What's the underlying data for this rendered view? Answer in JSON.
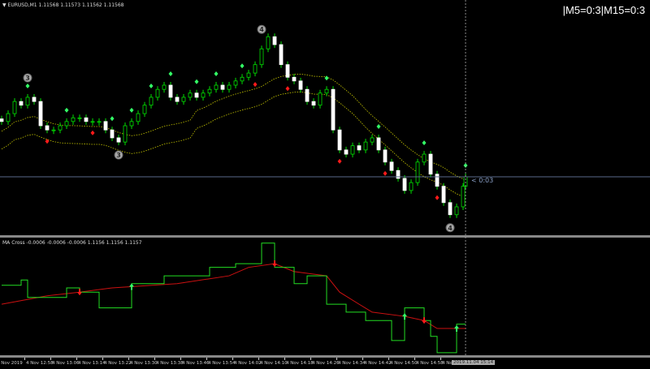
{
  "header": {
    "symbol_line": "▼ EURUSD,M1  1.11568 1.11573 1.11562 1.11568",
    "indicator_line": "MA Cross -0.0006 -0.0006 -0.0006    1.1156 1.1156 1.1157",
    "mtf_status": "|M5=0:3|M15=0:3",
    "countdown": "< 0:03"
  },
  "time_axis": {
    "labels": [
      "4 Nov 2019",
      "4 Nov 12:58",
      "4 Nov 13:06",
      "4 Nov 13:14",
      "4 Nov 13:22",
      "4 Nov 13:30",
      "4 Nov 13:38",
      "4 Nov 13:46",
      "4 Nov 13:54",
      "4 Nov 14:02",
      "4 Nov 14:10",
      "4 Nov 14:18",
      "4 Nov 14:26",
      "4 Nov 14:34",
      "4 Nov 14:42",
      "4 Nov 14:50",
      "4 Nov 14:58",
      "4 Nov 15:06"
    ],
    "cursor_time": "2019.11.04 15:14"
  },
  "colors": {
    "background": "#000000",
    "bull": "#00e000",
    "bear": "#ffffff",
    "band": "#c8c800",
    "fast_ma": "#22dd22",
    "slow_ma": "#cc1111",
    "buy_signal": "#33ff66",
    "sell_signal": "#ff1a1a",
    "crosshair": "#5a6a8a"
  },
  "chart_data": [
    {
      "type": "candlestick",
      "symbol": "EURUSD",
      "timeframe": "M1",
      "closes": [
        1.11673,
        1.11688,
        1.11711,
        1.11704,
        1.11719,
        1.11711,
        1.11665,
        1.11657,
        1.11657,
        1.11665,
        1.11673,
        1.1168,
        1.1168,
        1.11673,
        1.11673,
        1.11673,
        1.11657,
        1.11642,
        1.11634,
        1.11665,
        1.11673,
        1.11688,
        1.11704,
        1.11719,
        1.11734,
        1.11742,
        1.11719,
        1.11711,
        1.11719,
        1.11727,
        1.11719,
        1.11727,
        1.11734,
        1.11742,
        1.11734,
        1.11742,
        1.1175,
        1.11757,
        1.11765,
        1.11781,
        1.11811,
        1.11834,
        1.11819,
        1.11781,
        1.11757,
        1.1175,
        1.11734,
        1.11711,
        1.11704,
        1.11727,
        1.11734,
        1.11657,
        1.11619,
        1.11611,
        1.11627,
        1.11619,
        1.11634,
        1.11642,
        1.11619,
        1.11596,
        1.1158,
        1.11565,
        1.11542,
        1.11557,
        1.11596,
        1.11611,
        1.11573,
        1.1155,
        1.11519,
        1.11496,
        1.11511,
        1.1155,
        1.11568
      ],
      "last_bar": {
        "open": 1.11568,
        "high": 1.11573,
        "low": 1.11562,
        "close": 1.11568
      },
      "buy_signals": [
        4,
        10,
        17,
        20,
        23,
        26,
        30,
        33,
        37,
        50,
        58,
        65,
        72
      ],
      "sell_signals": [
        7,
        14,
        39,
        44,
        52,
        59,
        67
      ],
      "wave_labels": [
        {
          "bar": 4,
          "label": "3",
          "pos": "above"
        },
        {
          "bar": 18,
          "label": "3",
          "pos": "below"
        },
        {
          "bar": 40,
          "label": "4",
          "pos": "above"
        },
        {
          "bar": 69,
          "label": "4",
          "pos": "below"
        }
      ]
    },
    {
      "type": "line",
      "title": "MA Cross",
      "fast_steps": [
        [
          0,
          1.11642
        ],
        [
          3,
          1.11652
        ],
        [
          4,
          1.11619
        ],
        [
          10,
          1.11637
        ],
        [
          12,
          1.11629
        ],
        [
          15,
          1.11599
        ],
        [
          20,
          1.11645
        ],
        [
          25,
          1.1166
        ],
        [
          32,
          1.11676
        ],
        [
          36,
          1.11683
        ],
        [
          40,
          1.11722
        ],
        [
          42,
          1.11676
        ],
        [
          45,
          1.11645
        ],
        [
          47,
          1.1166
        ],
        [
          50,
          1.11606
        ],
        [
          53,
          1.11591
        ],
        [
          56,
          1.11575
        ],
        [
          60,
          1.11537
        ],
        [
          62,
          1.11599
        ],
        [
          65,
          1.11575
        ],
        [
          66,
          1.11545
        ],
        [
          67,
          1.11514
        ],
        [
          70,
          1.11568
        ]
      ],
      "slow_points": [
        [
          0,
          1.11606
        ],
        [
          7,
          1.11622
        ],
        [
          12,
          1.11629
        ],
        [
          17,
          1.11637
        ],
        [
          27,
          1.11645
        ],
        [
          35,
          1.1166
        ],
        [
          38,
          1.11676
        ],
        [
          42,
          1.11683
        ],
        [
          45,
          1.11668
        ],
        [
          50,
          1.1166
        ],
        [
          52,
          1.11629
        ],
        [
          55,
          1.11606
        ],
        [
          57,
          1.11591
        ],
        [
          62,
          1.11583
        ],
        [
          65,
          1.11575
        ],
        [
          67,
          1.1156
        ],
        [
          72,
          1.1156
        ]
      ],
      "cross_up": [
        20,
        62,
        70
      ],
      "cross_down": [
        12,
        42,
        65
      ]
    }
  ]
}
